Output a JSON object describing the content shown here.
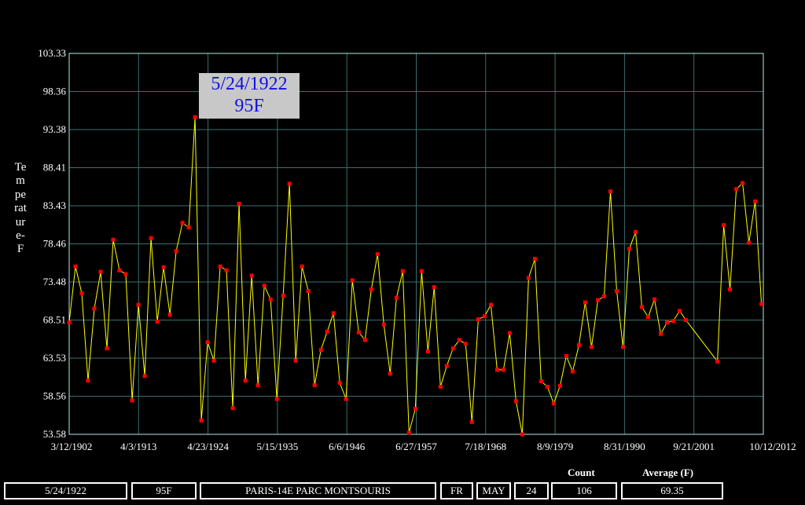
{
  "chart_data": {
    "type": "line",
    "ylabel": "Temperature-F",
    "ylim": [
      53.58,
      103.33
    ],
    "y_ticks": [
      "103.33",
      "98.36",
      "93.38",
      "88.41",
      "83.43",
      "78.46",
      "73.48",
      "68.51",
      "63.53",
      "58.56",
      "53.58"
    ],
    "x_tick_labels": [
      "3/12/1902",
      "4/3/1913",
      "4/23/1924",
      "5/15/1935",
      "6/6/1946",
      "6/27/1957",
      "7/18/1968",
      "8/9/1979",
      "8/31/1990",
      "9/21/2001",
      "10/12/2012"
    ],
    "grid": true,
    "colors": {
      "line": "#ffff00",
      "marker": "#ff0000",
      "grid": "#3a6e6e",
      "axes": "#b8e8e8"
    },
    "series": [
      {
        "x_years": [
          1902,
          1903,
          1904,
          1905,
          1906,
          1907,
          1908,
          1909,
          1910,
          1911,
          1912,
          1913,
          1914,
          1915,
          1916,
          1917,
          1918,
          1919,
          1920,
          1921,
          1922,
          1923,
          1924,
          1925,
          1926,
          1927,
          1928,
          1929,
          1930,
          1931,
          1932,
          1933,
          1934,
          1935,
          1936,
          1937,
          1938,
          1939,
          1940,
          1941,
          1942,
          1943,
          1944,
          1945,
          1946,
          1947,
          1948,
          1949,
          1950,
          1951,
          1952,
          1953,
          1954,
          1955,
          1956,
          1957,
          1958,
          1959,
          1960,
          1961,
          1962,
          1963,
          1964,
          1965,
          1966,
          1967,
          1968,
          1969,
          1970,
          1971,
          1972,
          1973,
          1974,
          1975,
          1976,
          1977,
          1978,
          1979,
          1980,
          1981,
          1982,
          1983,
          1984,
          1985,
          1986,
          1987,
          1988,
          1989,
          1990,
          1991,
          1992,
          1993,
          1994,
          1995,
          1996,
          1997,
          1998,
          1999,
          2000,
          2005,
          2006,
          2007,
          2008,
          2009,
          2010,
          2011,
          2012,
          2012.3
        ],
        "values": [
          68.2,
          75.5,
          72.0,
          60.6,
          70.0,
          74.8,
          64.8,
          79.0,
          75.0,
          74.5,
          58.0,
          70.5,
          61.2,
          79.2,
          68.3,
          75.4,
          69.2,
          77.5,
          81.2,
          80.6,
          95.0,
          55.4,
          65.6,
          63.2,
          75.5,
          75.0,
          57.0,
          83.7,
          60.6,
          74.3,
          60.0,
          73.0,
          71.2,
          58.2,
          71.7,
          86.3,
          63.2,
          75.5,
          72.3,
          60.0,
          64.6,
          67.0,
          69.4,
          60.3,
          58.2,
          73.7,
          66.9,
          65.9,
          72.5,
          77.1,
          67.9,
          61.5,
          71.4,
          74.9,
          53.8,
          56.9,
          74.9,
          64.4,
          72.8,
          59.8,
          62.5,
          64.8,
          65.9,
          65.4,
          55.2,
          68.6,
          69.0,
          70.5,
          62.0,
          62.0,
          66.8,
          57.9,
          52.5,
          74.0,
          76.5,
          60.5,
          59.8,
          57.6,
          59.9,
          63.8,
          61.8,
          65.2,
          70.8,
          65.0,
          71.1,
          71.6,
          85.3,
          72.3,
          65.0,
          77.8,
          80.0,
          70.2,
          68.9,
          71.2,
          66.7,
          68.2,
          68.4,
          69.7,
          68.5,
          63.1,
          80.9,
          72.5,
          85.6,
          86.4,
          78.6,
          84.0,
          70.6
        ]
      }
    ],
    "highlight": {
      "label": "5/24/1922",
      "value_label": "95F"
    }
  },
  "footer": {
    "date": "5/24/1922",
    "temp": "95F",
    "station": "PARIS-14E PARC MONTSOURIS",
    "country": "FR",
    "month": "MAY",
    "day": "24",
    "count_label": "Count",
    "count": "106",
    "average_label": "Average (F)",
    "average": "69.35"
  }
}
